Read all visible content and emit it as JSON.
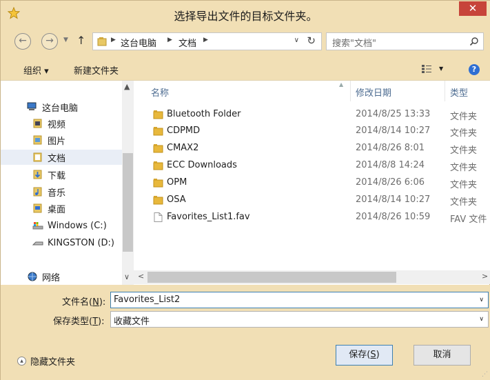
{
  "dialog": {
    "title": "选择导出文件的目标文件夹。",
    "close_label": "✕"
  },
  "address": {
    "segments": [
      "这台电脑",
      "文档"
    ],
    "search_placeholder": "搜索\"文档\""
  },
  "toolbar": {
    "organize_label": "组织 ▾",
    "new_folder_label": "新建文件夹",
    "help_label": "?"
  },
  "nav_pane": {
    "items": [
      {
        "label": "这台电脑",
        "icon": "computer-icon"
      },
      {
        "label": "视频",
        "icon": "videos-icon"
      },
      {
        "label": "图片",
        "icon": "pictures-icon"
      },
      {
        "label": "文档",
        "icon": "documents-icon",
        "selected": true
      },
      {
        "label": "下载",
        "icon": "downloads-icon"
      },
      {
        "label": "音乐",
        "icon": "music-icon"
      },
      {
        "label": "桌面",
        "icon": "desktop-icon"
      },
      {
        "label": "Windows (C:)",
        "icon": "drive-c-icon"
      },
      {
        "label": "KINGSTON (D:)",
        "icon": "usb-drive-icon"
      },
      {
        "label": "网络",
        "icon": "network-icon"
      }
    ]
  },
  "file_list": {
    "columns": {
      "name": "名称",
      "date": "修改日期",
      "type": "类型"
    },
    "rows": [
      {
        "name": "Bluetooth Folder",
        "date": "2014/8/25 13:33",
        "type": "文件夹",
        "icon": "folder-icon"
      },
      {
        "name": "CDPMD",
        "date": "2014/8/14 10:27",
        "type": "文件夹",
        "icon": "folder-icon"
      },
      {
        "name": "CMAX2",
        "date": "2014/8/26 8:01",
        "type": "文件夹",
        "icon": "folder-icon"
      },
      {
        "name": "ECC Downloads",
        "date": "2014/8/8 14:24",
        "type": "文件夹",
        "icon": "folder-icon"
      },
      {
        "name": "OPM",
        "date": "2014/8/26 6:06",
        "type": "文件夹",
        "icon": "folder-icon"
      },
      {
        "name": "OSA",
        "date": "2014/8/14 10:27",
        "type": "文件夹",
        "icon": "folder-icon"
      },
      {
        "name": "Favorites_List1.fav",
        "date": "2014/8/26 10:59",
        "type": "FAV 文件",
        "icon": "file-icon"
      }
    ]
  },
  "form": {
    "filename_label_pre": "文件名(",
    "filename_label_key": "N",
    "filename_label_post": "):",
    "filename_value": "Favorites_List2",
    "filetype_label_pre": "保存类型(",
    "filetype_label_key": "T",
    "filetype_label_post": "):",
    "filetype_value": "收藏文件"
  },
  "buttons": {
    "save_pre": "保存(",
    "save_key": "S",
    "save_post": ")",
    "cancel": "取消",
    "hide_folders": "隐藏文件夹"
  },
  "colors": {
    "chrome": "#f1dfb5",
    "close": "#c7443a",
    "folder": "#e8b83c",
    "header_text": "#4d6c91"
  }
}
